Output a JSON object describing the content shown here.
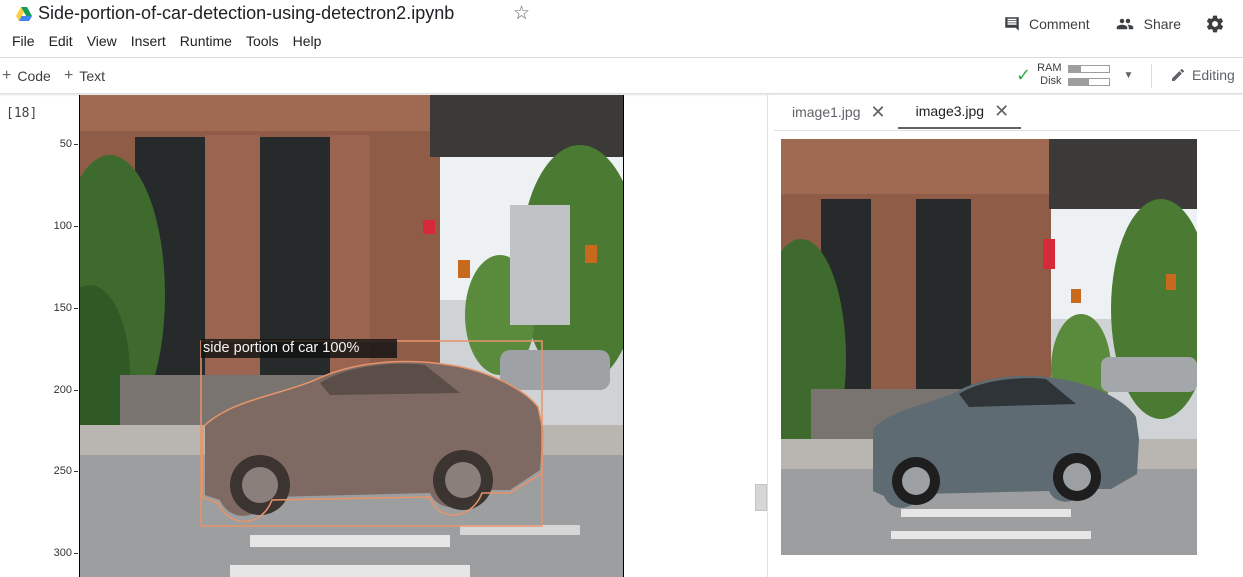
{
  "header": {
    "title": "Side-portion-of-car-detection-using-detectron2.ipynb",
    "menu": [
      "File",
      "Edit",
      "View",
      "Insert",
      "Runtime",
      "Tools",
      "Help"
    ],
    "comment_label": "Comment",
    "share_label": "Share",
    "icons": {
      "logo": "google-drive-icon",
      "star": "star-icon",
      "comment": "comment-icon",
      "share": "people-icon",
      "settings": "gear-icon"
    }
  },
  "toolbar": {
    "add_code": "Code",
    "add_text": "Text",
    "ram_label": "RAM",
    "disk_label": "Disk",
    "ram_usage": 0.3,
    "disk_usage": 0.5,
    "editing_label": "Editing",
    "colors": {
      "connected": "#34a853"
    }
  },
  "cell": {
    "exec_count": "[18]",
    "y_ticks": [
      "50",
      "100",
      "150",
      "200",
      "250",
      "300"
    ],
    "detection_label": "side portion of car 100%"
  },
  "panel": {
    "tabs": [
      {
        "label": "image1.jpg",
        "active": false
      },
      {
        "label": "image3.jpg",
        "active": true
      }
    ]
  }
}
